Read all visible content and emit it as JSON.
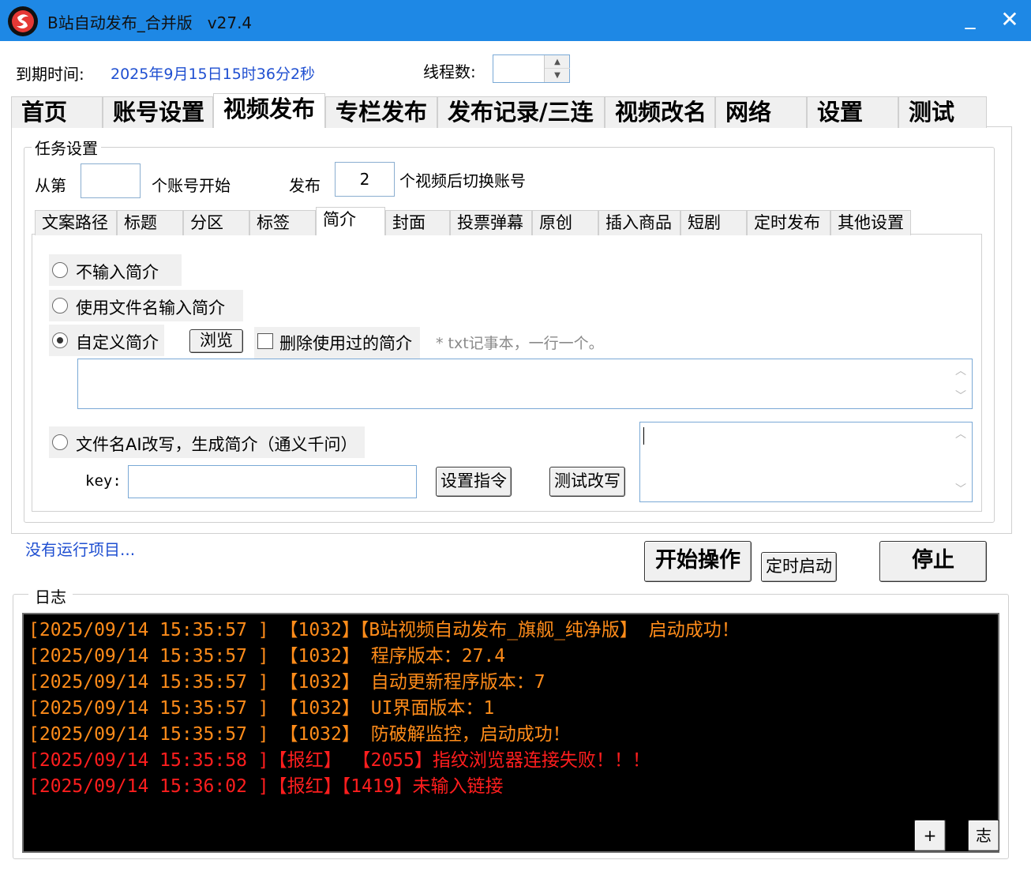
{
  "window": {
    "title": "B站自动发布_合并版   v27.4",
    "minimize_symbol": "_",
    "close_symbol": "✕"
  },
  "header": {
    "expire_label": "到期时间:",
    "expire_value": "2025年9月15日15时36分2秒",
    "threads_label": "线程数:",
    "threads_value": ""
  },
  "main_tabs": [
    {
      "label": "首页"
    },
    {
      "label": "账号设置"
    },
    {
      "label": "视频发布"
    },
    {
      "label": "专栏发布"
    },
    {
      "label": "发布记录/三连"
    },
    {
      "label": "视频改名"
    },
    {
      "label": "网络"
    },
    {
      "label": "设置"
    },
    {
      "label": "测试"
    }
  ],
  "active_main_tab": "视频发布",
  "task": {
    "group_title": "任务设置",
    "from_label": "从第",
    "start_value": "",
    "start_suffix": "个账号开始",
    "publish_label": "发布",
    "switch_count": "2",
    "switch_suffix": "个视频后切换账号"
  },
  "sub_tabs": [
    {
      "label": "文案路径"
    },
    {
      "label": "标题"
    },
    {
      "label": "分区"
    },
    {
      "label": "标签"
    },
    {
      "label": "简介"
    },
    {
      "label": "封面"
    },
    {
      "label": "投票弹幕"
    },
    {
      "label": "原创"
    },
    {
      "label": "插入商品"
    },
    {
      "label": "短剧"
    },
    {
      "label": "定时发布"
    },
    {
      "label": "其他设置"
    }
  ],
  "active_sub_tab": "简介",
  "intro": {
    "opt_none": "不输入简介",
    "opt_filename": "使用文件名输入简介",
    "opt_custom": "自定义简介",
    "browse_button": "浏览",
    "delete_used_label": "删除使用过的简介",
    "delete_used_checked": false,
    "hint": "* txt记事本，一行一个。",
    "custom_text": "",
    "opt_ai": "文件名AI改写，生成简介（通义千问）",
    "key_label": "key:",
    "key_value": "",
    "set_prompt_button": "设置指令",
    "test_rewrite_button": "测试改写",
    "ai_output": "",
    "selected": "custom"
  },
  "status": {
    "text": "没有运行项目..."
  },
  "actions": {
    "start_button": "开始操作",
    "timed_start_button": "定时启动",
    "stop_button": "停止"
  },
  "log": {
    "title": "日志",
    "lines": [
      {
        "text": "[2025/09/14 15:35:57 ] 【1032】【B站视频自动发布_旗舰_纯净版】 启动成功！",
        "level": "info"
      },
      {
        "text": "[2025/09/14 15:35:57 ] 【1032】 程序版本：27.4",
        "level": "info"
      },
      {
        "text": "[2025/09/14 15:35:57 ] 【1032】 自动更新程序版本：7",
        "level": "info"
      },
      {
        "text": "[2025/09/14 15:35:57 ] 【1032】 UI界面版本：1",
        "level": "info"
      },
      {
        "text": "[2025/09/14 15:35:57 ] 【1032】 防破解监控，启动成功！",
        "level": "info"
      },
      {
        "text": "[2025/09/14 15:35:58 ]【报红】 【2055】指纹浏览器连接失败！！！",
        "level": "error"
      },
      {
        "text": "[2025/09/14 15:36:02 ]【报红】【1419】未输入链接",
        "level": "error"
      }
    ],
    "plus_button": "+",
    "log_button": "志"
  },
  "colors": {
    "titlebar": "#1e88e5",
    "link_blue": "#1f4fd1",
    "log_info": "#ff8c1a",
    "log_error": "#ff1e1e",
    "log_bg": "#000000"
  }
}
